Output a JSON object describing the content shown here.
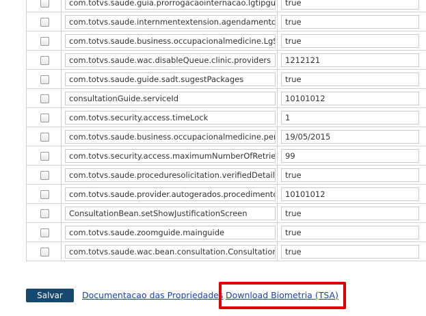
{
  "properties": [
    {
      "key": "com.totvs.saude.guia.prorrogacaointernacao.lgtipguiatr",
      "value": "true"
    },
    {
      "key": "com.totvs.saude.internmentextension.agendamento.futu",
      "value": "true"
    },
    {
      "key": "com.totvs.saude.business.occupacionalmedicine.LgSele",
      "value": "true"
    },
    {
      "key": "com.totvs.saude.wac.disableQueue.clinic.providers",
      "value": "1212121"
    },
    {
      "key": "com.totvs.saude.guide.sadt.sugestPackages",
      "value": "true"
    },
    {
      "key": "consultationGuide.serviceId",
      "value": "10101012"
    },
    {
      "key": "com.totvs.security.access.timeLock",
      "value": "1"
    },
    {
      "key": "com.totvs.saude.business.occupacionalmedicine.period",
      "value": "19/05/2015"
    },
    {
      "key": "com.totvs.security.access.maximumNumberOfRetries",
      "value": "99"
    },
    {
      "key": "com.totvs.saude.proceduresolicitation.verifiedDetails",
      "value": "true"
    },
    {
      "key": "com.totvs.saude.provider.autogerados.procedimentoPe",
      "value": "10101012"
    },
    {
      "key": "ConsultationBean.setShowJustificationScreen",
      "value": "true"
    },
    {
      "key": "com.totvs.saude.zoomguide.mainguide",
      "value": "true"
    },
    {
      "key": "com.totvs.saude.wac.bean.consultation.ConsultationBe",
      "value": "true"
    }
  ],
  "footer": {
    "save_label": "Salvar",
    "doc_link_label": "Documentacao das Propriedades",
    "biometry_link_label": "Download Biometria (TSA)"
  },
  "colors": {
    "save_button_bg": "#17486d",
    "link": "#1a3ec9",
    "highlight": "#e00000"
  }
}
